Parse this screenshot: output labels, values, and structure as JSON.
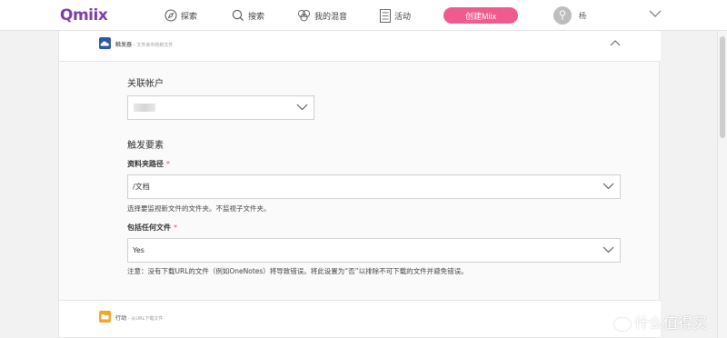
{
  "nav": {
    "logo": "Qmiix",
    "explore": "探索",
    "search": "搜索",
    "my_mixes": "我的混音",
    "activity": "活动",
    "create_button": "创建Miix",
    "user": "杨"
  },
  "trigger": {
    "title": "触发器",
    "subtitle": "- 文件夹中的新文件",
    "account_label": "关联帐户",
    "elements_heading": "触发要素",
    "folder_path_label": "资料夹路径",
    "folder_path_value": "/文档",
    "folder_hint": "选择要监视新文件的文件夹。不监视子文件夹。",
    "include_label": "包括任何文件",
    "include_value": "Yes",
    "note": "注意：没有下载URL的文件（例如OneNotes）将导致错误。将此设置为“否”以排除不可下载的文件并避免错误。",
    "required_mark": "*"
  },
  "action": {
    "title": "行动",
    "subtitle": "- 从URL下载文件"
  },
  "watermark": "什么值得买",
  "colors": {
    "brand": "#7b3fa8",
    "create": "#ef5b8e",
    "trigger_icon": "#2b57a8",
    "action_icon": "#f5a623"
  }
}
